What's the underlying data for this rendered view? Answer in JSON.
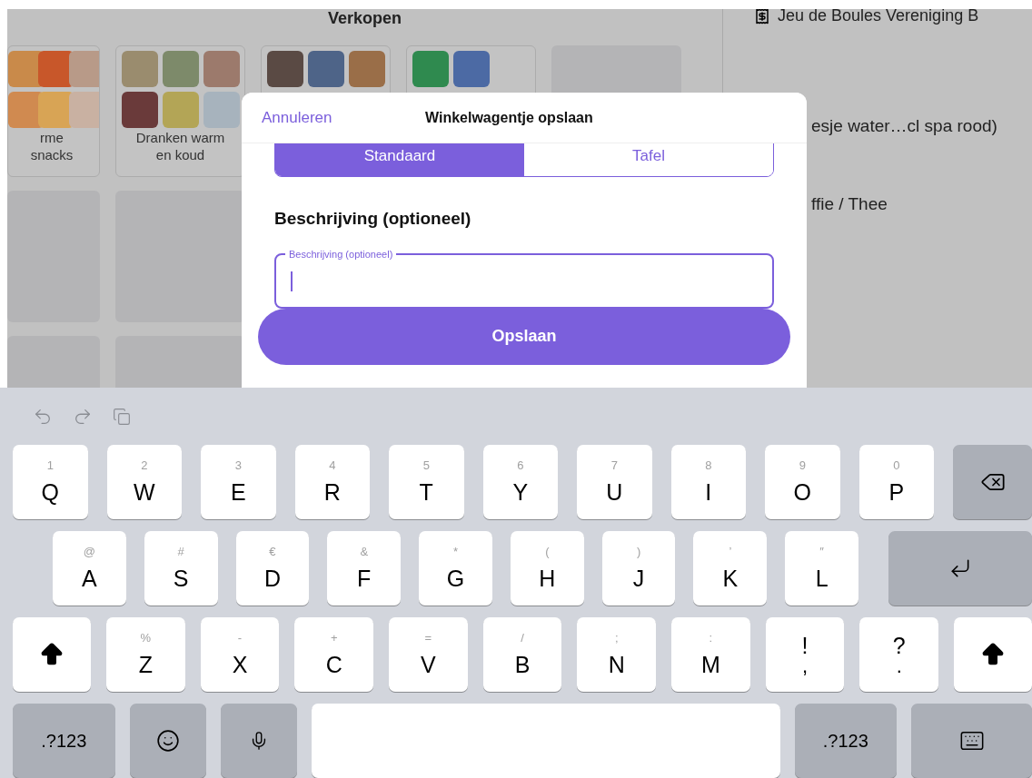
{
  "sale_screen": {
    "title": "Verkopen",
    "rows": [
      [
        {
          "kind": "product",
          "label": "rme snacks",
          "tiles": [
            {
              "color": "#c98a4a"
            },
            {
              "color": "#c8572a"
            },
            {
              "color": "#b89a88"
            },
            {
              "color": "#d08a50"
            },
            {
              "color": "#d8a455"
            },
            {
              "color": "#c9b1a2"
            }
          ]
        },
        {
          "kind": "product",
          "label": "Dranken warm en koud",
          "tiles": [
            {
              "color": "#9a8c6e"
            },
            {
              "color": "#7d8a6a"
            },
            {
              "color": "#9c7a6c"
            },
            {
              "color": "#6a3a3a"
            },
            {
              "color": "#b3a556"
            },
            {
              "color": "#a7b3bd"
            }
          ]
        },
        {
          "kind": "product",
          "tiles": [
            {
              "color": "#5a4a44"
            },
            {
              "color": "#4e6488"
            },
            {
              "color": "#9a6e48"
            }
          ]
        },
        {
          "kind": "product",
          "tiles": [
            {
              "color": "#2f8a4f"
            },
            {
              "color": "#4c6aa4"
            }
          ]
        },
        {
          "kind": "empty"
        }
      ],
      [
        {
          "kind": "empty"
        },
        {
          "kind": "empty"
        }
      ],
      [
        {
          "kind": "empty"
        },
        {
          "kind": "empty"
        }
      ]
    ]
  },
  "order_panel": {
    "title": "Jeu de Boules Vereniging B",
    "items": [
      "esje water…cl spa rood)",
      "ffie / Thee"
    ]
  },
  "dialog": {
    "cancel": "Annuleren",
    "title": "Winkelwagentje opslaan",
    "segments": [
      {
        "label": "Standaard",
        "selected": true
      },
      {
        "label": "Tafel",
        "selected": false
      }
    ],
    "section_label": "Beschrijving (optioneel)",
    "field": {
      "label": "Beschrijving (optioneel)",
      "focused": true
    },
    "save": "Opslaan"
  },
  "keyboard": {
    "rows": [
      [
        {
          "kind": "key",
          "label": "Q",
          "hint": "1"
        },
        {
          "kind": "key",
          "label": "W",
          "hint": "2"
        },
        {
          "kind": "key",
          "label": "E",
          "hint": "3"
        },
        {
          "kind": "key",
          "label": "R",
          "hint": "4"
        },
        {
          "kind": "key",
          "label": "T",
          "hint": "5"
        },
        {
          "kind": "key",
          "label": "Y",
          "hint": "6"
        },
        {
          "kind": "key",
          "label": "U",
          "hint": "7"
        },
        {
          "kind": "key",
          "label": "I",
          "hint": "8"
        },
        {
          "kind": "key",
          "label": "O",
          "hint": "9"
        },
        {
          "kind": "key",
          "label": "P",
          "hint": "0"
        },
        {
          "kind": "backspace"
        }
      ],
      [
        {
          "kind": "key",
          "label": "A",
          "hint": "@"
        },
        {
          "kind": "key",
          "label": "S",
          "hint": "#"
        },
        {
          "kind": "key",
          "label": "D",
          "hint": "€"
        },
        {
          "kind": "key",
          "label": "F",
          "hint": "&"
        },
        {
          "kind": "key",
          "label": "G",
          "hint": "*"
        },
        {
          "kind": "key",
          "label": "H",
          "hint": "("
        },
        {
          "kind": "key",
          "label": "J",
          "hint": ")"
        },
        {
          "kind": "key",
          "label": "K",
          "hint": "’"
        },
        {
          "kind": "key",
          "label": "L",
          "hint": "″"
        },
        {
          "kind": "return"
        }
      ],
      [
        {
          "kind": "shift"
        },
        {
          "kind": "key",
          "label": "Z",
          "hint": "%"
        },
        {
          "kind": "key",
          "label": "X",
          "hint": "-"
        },
        {
          "kind": "key",
          "label": "C",
          "hint": "+"
        },
        {
          "kind": "key",
          "label": "V",
          "hint": "="
        },
        {
          "kind": "key",
          "label": "B",
          "hint": "/"
        },
        {
          "kind": "key",
          "label": "N",
          "hint": ";"
        },
        {
          "kind": "key",
          "label": "M",
          "hint": ":"
        },
        {
          "kind": "punct",
          "label": "!",
          "sub": ","
        },
        {
          "kind": "punct",
          "label": "?",
          "sub": "."
        },
        {
          "kind": "shift"
        }
      ],
      [
        {
          "kind": "mode",
          "label": ".?123"
        },
        {
          "kind": "emoji"
        },
        {
          "kind": "mic"
        },
        {
          "kind": "space"
        },
        {
          "kind": "mode",
          "label": ".?123"
        },
        {
          "kind": "hide"
        }
      ]
    ]
  }
}
